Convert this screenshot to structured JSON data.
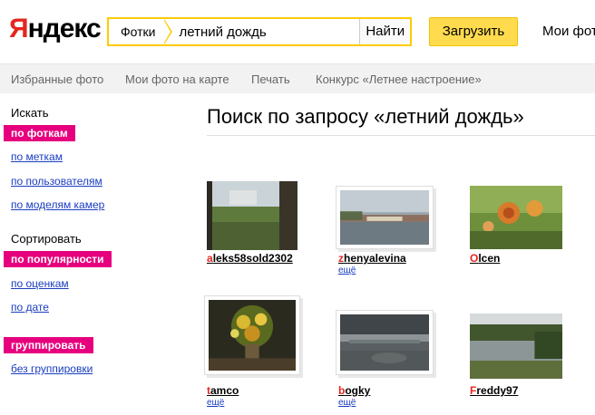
{
  "header": {
    "logo_first": "Я",
    "logo_rest": "ндекс",
    "search_tag": "Фотки",
    "search_value": "летний дождь",
    "search_button": "Найти",
    "upload_button": "Загрузить",
    "my_photos": "Мои фот"
  },
  "nav": {
    "items": [
      "Избранные фото",
      "Мои фото на карте",
      "Печать",
      "Конкурс «Летнее настроение»"
    ]
  },
  "sidebar": {
    "search_heading": "Искать",
    "search_active": "по фоткам",
    "search_links": [
      "по меткам",
      "по пользователям",
      "по моделям камер"
    ],
    "sort_heading": "Сортировать",
    "sort_active": "по популярности",
    "sort_links": [
      "по оценкам",
      "по дате"
    ],
    "group_active": "группировать",
    "group_links": [
      "без группировки"
    ]
  },
  "main": {
    "title": "Поиск по запросу «летний дождь»",
    "results": [
      {
        "author_first": "a",
        "author_rest": "leks58sold2302",
        "more": ""
      },
      {
        "author_first": "z",
        "author_rest": "henyalevina",
        "more": "ещё"
      },
      {
        "author_first": "O",
        "author_rest": "lcen",
        "more": ""
      },
      {
        "author_first": "t",
        "author_rest": "amco",
        "more": "ещё"
      },
      {
        "author_first": "b",
        "author_rest": "ogky",
        "more": "ещё"
      },
      {
        "author_first": "F",
        "author_rest": "reddy97",
        "more": ""
      }
    ]
  },
  "colors": {
    "accent_yellow": "#ffdb4d",
    "active_magenta": "#e6007e",
    "link_blue": "#1a3dc1",
    "logo_red": "#e52620"
  }
}
